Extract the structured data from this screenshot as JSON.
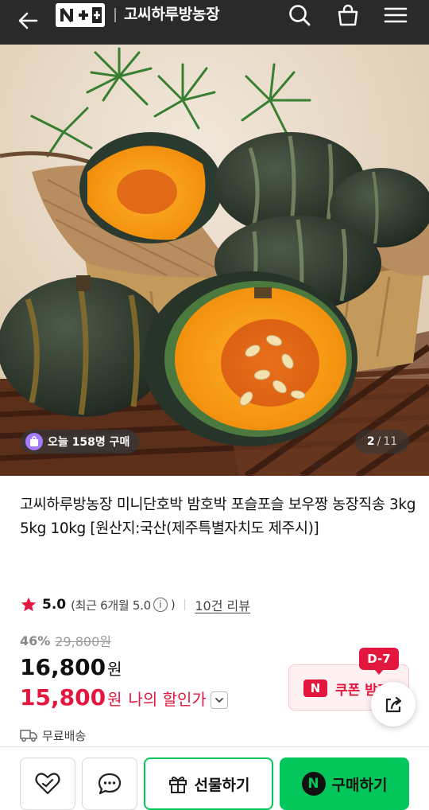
{
  "header": {
    "logo_text": "N+",
    "store_name": "고씨하루방농장"
  },
  "gallery": {
    "buyers_badge": "오늘 158명 구매",
    "current": "2",
    "separator": "/",
    "total": "11"
  },
  "product": {
    "title": "고씨하루방농장 미니단호박 밤호박 포슬포슬 보우짱 농장직송 3kg 5kg 10kg [원산지:국산(제주특별자치도 제주시)]",
    "rating": "5.0",
    "rating_recent": "(최근 6개월 5.0",
    "rating_close": ")",
    "info_icon": "i",
    "review_link": "10건 리뷰",
    "discount_rate": "46%",
    "original_price": "29,800원",
    "sale_price": "16,800",
    "currency": "원",
    "my_price": "15,800",
    "my_price_label": "나의 할인가",
    "shipping": "무료배송"
  },
  "coupon": {
    "badge": "D-7",
    "n_mark": "N",
    "label": "쿠폰 받기"
  },
  "bottom_bar": {
    "gift_label": "선물하기",
    "buy_mark": "N",
    "buy_label": "구매하기"
  },
  "colors": {
    "header_bg": "#2a2a2a",
    "accent_red": "#e3173e",
    "naver_green": "#03c75a"
  }
}
